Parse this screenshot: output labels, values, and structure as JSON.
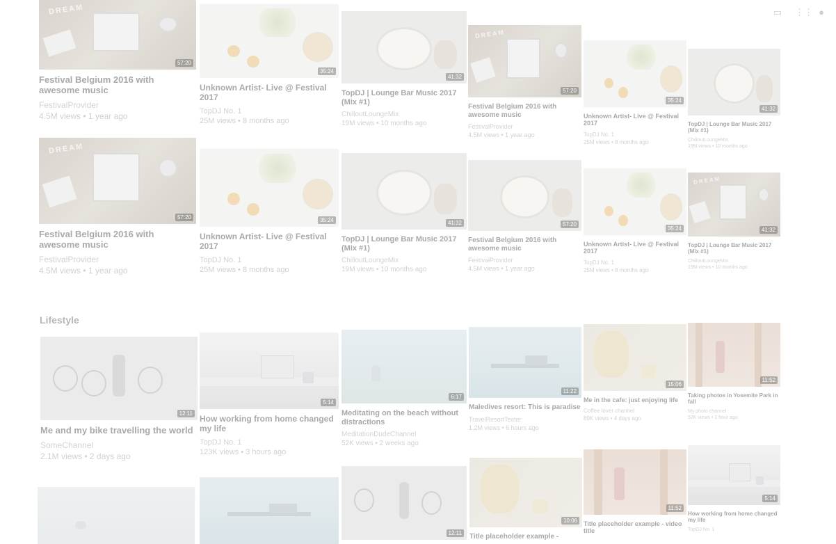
{
  "header": {
    "icons": [
      "video-camera-icon",
      "apps-grid-icon",
      "notifications-bell-icon"
    ]
  },
  "sections": {
    "lifestyle": "Lifestyle"
  },
  "row1": [
    {
      "title": "Festival Belgium 2016 with awesome music",
      "channel": "FestivalProvider",
      "meta": "4.5M views • 1 year ago",
      "duration": "57:20"
    },
    {
      "title": "Unknown Artist- Live @ Festival 2017",
      "channel": "TopDJ No. 1",
      "meta": "25M views • 8 months ago",
      "duration": "35:24"
    },
    {
      "title": "TopDJ | Lounge Bar Music 2017 (Mix #1)",
      "channel": "ChilloutLoungeMix",
      "meta": "19M views • 10 months ago",
      "duration": "41:32"
    },
    {
      "title": "Festival Belgium 2016 with awesome music",
      "channel": "FestivalProvider",
      "meta": "4.5M views • 1 year ago",
      "duration": "57:20"
    },
    {
      "title": "Unknown Artist- Live @ Festival 2017",
      "channel": "TopDJ No. 1",
      "meta": "25M views • 8 months ago",
      "duration": "35:24"
    },
    {
      "title": "TopDJ | Lounge Bar Music 2017 (Mix #1)",
      "channel": "ChilloutLoungeMix",
      "meta": "19M views • 10 months ago",
      "duration": "41:32"
    }
  ],
  "row2": [
    {
      "title": "Festival Belgium 2016 with awesome music",
      "channel": "FestivalProvider",
      "meta": "4.5M views • 1 year ago",
      "duration": "57:20"
    },
    {
      "title": "Unknown Artist- Live @ Festival 2017",
      "channel": "TopDJ No. 1",
      "meta": "25M views • 8 months ago",
      "duration": "35:24"
    },
    {
      "title": "TopDJ | Lounge Bar Music 2017 (Mix #1)",
      "channel": "ChilloutLoungeMix",
      "meta": "19M views • 10 months ago",
      "duration": "41:32"
    },
    {
      "title": "Festival Belgium 2016 with awesome music",
      "channel": "FestivalProvider",
      "meta": "4.5M views • 1 year ago",
      "duration": "57:20"
    },
    {
      "title": "Unknown Artist- Live @ Festival 2017",
      "channel": "TopDJ No. 1",
      "meta": "25M views • 8 months ago",
      "duration": "35:24"
    },
    {
      "title": "TopDJ | Lounge Bar Music 2017 (Mix #1)",
      "channel": "ChilloutLoungeMix",
      "meta": "19M views • 10 months ago",
      "duration": "41:32"
    }
  ],
  "row3": [
    {
      "title": "Me and my bike travelling the world",
      "channel": "SomeChannel",
      "meta": "2.1M views • 2 days ago",
      "duration": "12:11"
    },
    {
      "title": "How working from home changed my life",
      "channel": "TopDJ No. 1",
      "meta": "123K views • 3 hours ago",
      "duration": "5:14"
    },
    {
      "title": "Meditating on the beach without distractions",
      "channel": "MeditationDudeChannel",
      "meta": "52K views • 2 weeks ago",
      "duration": "6:17"
    },
    {
      "title": "Maledives resort: This is paradise",
      "channel": "TravelResortTester",
      "meta": "1.2M views • 6 hours ago",
      "duration": "11:22"
    },
    {
      "title": "Me in the cafe: just enjoying life",
      "channel": "Coffee lover channel",
      "meta": "80K views • 4 days ago",
      "duration": "15:06"
    },
    {
      "title": "Taking photos in Yosemite Park in fall",
      "channel": "My photo channel",
      "meta": "52K views • 1 hour ago",
      "duration": "11:52"
    }
  ],
  "row4": [
    {
      "title": "",
      "duration": ""
    },
    {
      "title": "",
      "duration": ""
    },
    {
      "title": "",
      "duration": "12:11"
    },
    {
      "title": "Title placeholder example -",
      "duration": "10:06"
    },
    {
      "title": "Title placeholder example - video title",
      "duration": "11:52"
    },
    {
      "title": "How working from home changed my life",
      "channel": "TopDJ No. 1",
      "duration": "5:14"
    }
  ]
}
